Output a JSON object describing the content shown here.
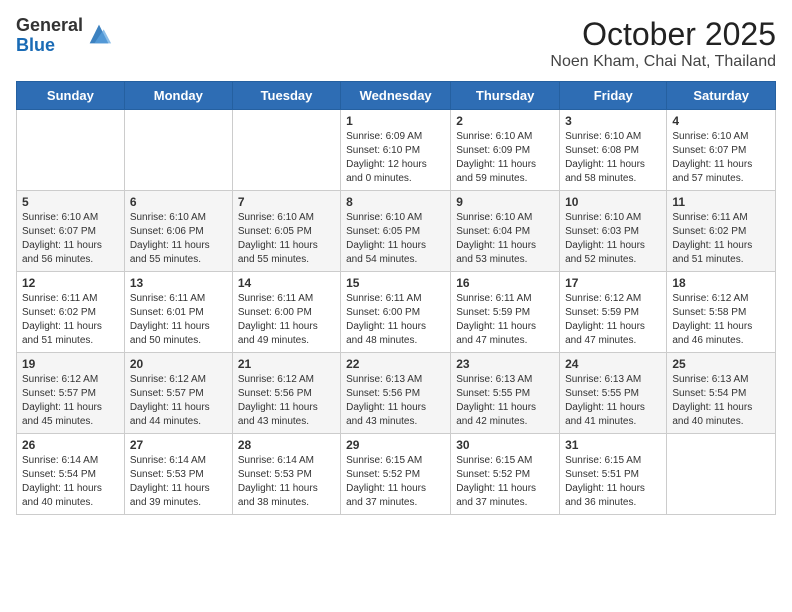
{
  "header": {
    "logo_general": "General",
    "logo_blue": "Blue",
    "month": "October 2025",
    "location": "Noen Kham, Chai Nat, Thailand"
  },
  "weekdays": [
    "Sunday",
    "Monday",
    "Tuesday",
    "Wednesday",
    "Thursday",
    "Friday",
    "Saturday"
  ],
  "weeks": [
    [
      {
        "day": "",
        "info": ""
      },
      {
        "day": "",
        "info": ""
      },
      {
        "day": "",
        "info": ""
      },
      {
        "day": "1",
        "info": "Sunrise: 6:09 AM\nSunset: 6:10 PM\nDaylight: 12 hours\nand 0 minutes."
      },
      {
        "day": "2",
        "info": "Sunrise: 6:10 AM\nSunset: 6:09 PM\nDaylight: 11 hours\nand 59 minutes."
      },
      {
        "day": "3",
        "info": "Sunrise: 6:10 AM\nSunset: 6:08 PM\nDaylight: 11 hours\nand 58 minutes."
      },
      {
        "day": "4",
        "info": "Sunrise: 6:10 AM\nSunset: 6:07 PM\nDaylight: 11 hours\nand 57 minutes."
      }
    ],
    [
      {
        "day": "5",
        "info": "Sunrise: 6:10 AM\nSunset: 6:07 PM\nDaylight: 11 hours\nand 56 minutes."
      },
      {
        "day": "6",
        "info": "Sunrise: 6:10 AM\nSunset: 6:06 PM\nDaylight: 11 hours\nand 55 minutes."
      },
      {
        "day": "7",
        "info": "Sunrise: 6:10 AM\nSunset: 6:05 PM\nDaylight: 11 hours\nand 55 minutes."
      },
      {
        "day": "8",
        "info": "Sunrise: 6:10 AM\nSunset: 6:05 PM\nDaylight: 11 hours\nand 54 minutes."
      },
      {
        "day": "9",
        "info": "Sunrise: 6:10 AM\nSunset: 6:04 PM\nDaylight: 11 hours\nand 53 minutes."
      },
      {
        "day": "10",
        "info": "Sunrise: 6:10 AM\nSunset: 6:03 PM\nDaylight: 11 hours\nand 52 minutes."
      },
      {
        "day": "11",
        "info": "Sunrise: 6:11 AM\nSunset: 6:02 PM\nDaylight: 11 hours\nand 51 minutes."
      }
    ],
    [
      {
        "day": "12",
        "info": "Sunrise: 6:11 AM\nSunset: 6:02 PM\nDaylight: 11 hours\nand 51 minutes."
      },
      {
        "day": "13",
        "info": "Sunrise: 6:11 AM\nSunset: 6:01 PM\nDaylight: 11 hours\nand 50 minutes."
      },
      {
        "day": "14",
        "info": "Sunrise: 6:11 AM\nSunset: 6:00 PM\nDaylight: 11 hours\nand 49 minutes."
      },
      {
        "day": "15",
        "info": "Sunrise: 6:11 AM\nSunset: 6:00 PM\nDaylight: 11 hours\nand 48 minutes."
      },
      {
        "day": "16",
        "info": "Sunrise: 6:11 AM\nSunset: 5:59 PM\nDaylight: 11 hours\nand 47 minutes."
      },
      {
        "day": "17",
        "info": "Sunrise: 6:12 AM\nSunset: 5:59 PM\nDaylight: 11 hours\nand 47 minutes."
      },
      {
        "day": "18",
        "info": "Sunrise: 6:12 AM\nSunset: 5:58 PM\nDaylight: 11 hours\nand 46 minutes."
      }
    ],
    [
      {
        "day": "19",
        "info": "Sunrise: 6:12 AM\nSunset: 5:57 PM\nDaylight: 11 hours\nand 45 minutes."
      },
      {
        "day": "20",
        "info": "Sunrise: 6:12 AM\nSunset: 5:57 PM\nDaylight: 11 hours\nand 44 minutes."
      },
      {
        "day": "21",
        "info": "Sunrise: 6:12 AM\nSunset: 5:56 PM\nDaylight: 11 hours\nand 43 minutes."
      },
      {
        "day": "22",
        "info": "Sunrise: 6:13 AM\nSunset: 5:56 PM\nDaylight: 11 hours\nand 43 minutes."
      },
      {
        "day": "23",
        "info": "Sunrise: 6:13 AM\nSunset: 5:55 PM\nDaylight: 11 hours\nand 42 minutes."
      },
      {
        "day": "24",
        "info": "Sunrise: 6:13 AM\nSunset: 5:55 PM\nDaylight: 11 hours\nand 41 minutes."
      },
      {
        "day": "25",
        "info": "Sunrise: 6:13 AM\nSunset: 5:54 PM\nDaylight: 11 hours\nand 40 minutes."
      }
    ],
    [
      {
        "day": "26",
        "info": "Sunrise: 6:14 AM\nSunset: 5:54 PM\nDaylight: 11 hours\nand 40 minutes."
      },
      {
        "day": "27",
        "info": "Sunrise: 6:14 AM\nSunset: 5:53 PM\nDaylight: 11 hours\nand 39 minutes."
      },
      {
        "day": "28",
        "info": "Sunrise: 6:14 AM\nSunset: 5:53 PM\nDaylight: 11 hours\nand 38 minutes."
      },
      {
        "day": "29",
        "info": "Sunrise: 6:15 AM\nSunset: 5:52 PM\nDaylight: 11 hours\nand 37 minutes."
      },
      {
        "day": "30",
        "info": "Sunrise: 6:15 AM\nSunset: 5:52 PM\nDaylight: 11 hours\nand 37 minutes."
      },
      {
        "day": "31",
        "info": "Sunrise: 6:15 AM\nSunset: 5:51 PM\nDaylight: 11 hours\nand 36 minutes."
      },
      {
        "day": "",
        "info": ""
      }
    ]
  ]
}
